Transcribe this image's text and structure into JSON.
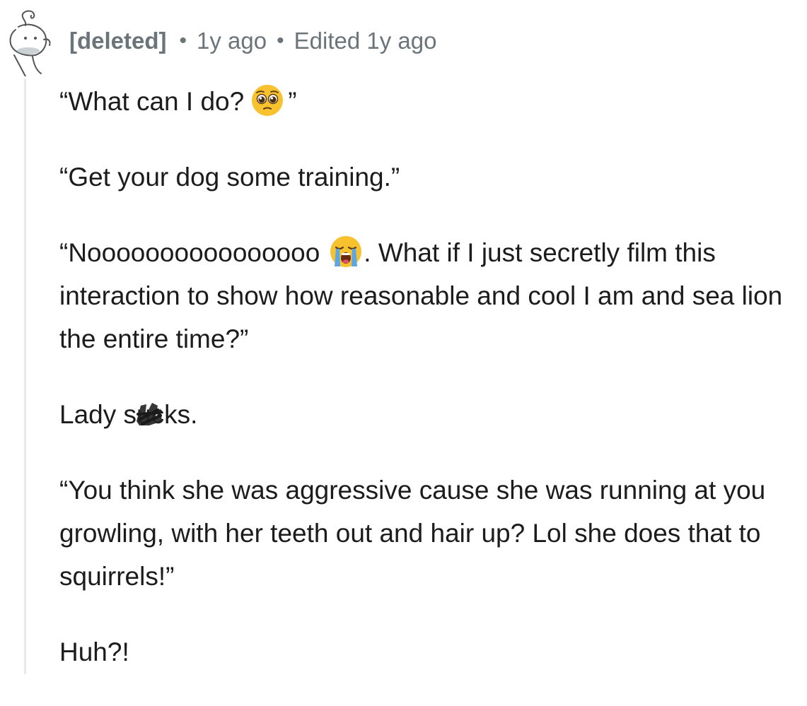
{
  "comment": {
    "author": "[deleted]",
    "separator": "•",
    "age": "1y ago",
    "edited": "Edited 1y ago"
  },
  "paragraphs": {
    "p1": {
      "before": "“What can I do?",
      "after": "”"
    },
    "p2": {
      "text": "“Get your dog some training.”"
    },
    "p3": {
      "before": "“Noooooooooooooooo",
      "after": ". What if I just secretly film this interaction to show how reasonable and cool I am and sea lion the entire time?”"
    },
    "p4": {
      "before": "Lady s",
      "mid": "uc",
      "after": "ks."
    },
    "p5": {
      "text": "“You think she was aggressive cause she was running at you growling, with her teeth out and hair up? Lol she does that to squirrels!”"
    },
    "p6": {
      "text": "Huh?!"
    }
  },
  "icons": {
    "avatar": "snoo-ghost-avatar",
    "emoji_1": "pleading-face-emoji",
    "emoji_2": "loudly-crying-face-emoji",
    "redaction": "scribble-redaction"
  },
  "colors": {
    "meta_text": "#6b7479",
    "body_text": "#1c1c1c",
    "thread_line": "#e9e9e9",
    "emoji_yellow": "#f7c22e",
    "tears_blue": "#5aa6e6"
  }
}
